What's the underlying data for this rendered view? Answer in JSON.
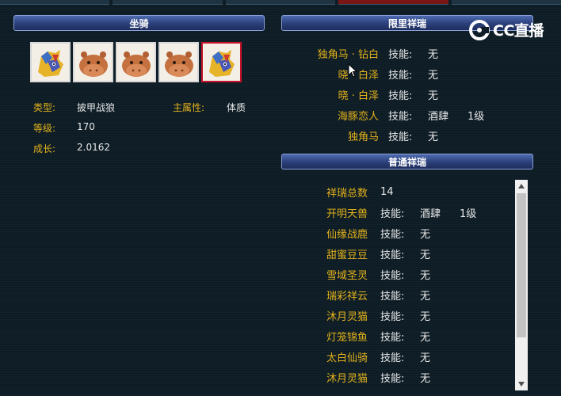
{
  "left_panel": {
    "title": "坐骑",
    "mounts": [
      {
        "icon": "dragon-mount-icon",
        "selected": false
      },
      {
        "icon": "hippo-mount-icon",
        "selected": false
      },
      {
        "icon": "hippo-mount-icon",
        "selected": false
      },
      {
        "icon": "hippo-mount-icon",
        "selected": false
      },
      {
        "icon": "dragon-mount-icon",
        "selected": true
      }
    ],
    "type_label": "类型:",
    "type_value": "披甲战狼",
    "main_attr_label": "主属性:",
    "main_attr_value": "体质",
    "level_label": "等级:",
    "level_value": "170",
    "growth_label": "成长:",
    "growth_value": "2.0162"
  },
  "limited_panel": {
    "title": "限里祥瑞",
    "rows": [
      {
        "name": "独角马 · 钻白",
        "skill_label": "技能:",
        "skill": "无",
        "level": ""
      },
      {
        "name": "晓 · 白泽",
        "skill_label": "技能:",
        "skill": "无",
        "level": ""
      },
      {
        "name": "晓 · 白泽",
        "skill_label": "技能:",
        "skill": "无",
        "level": ""
      },
      {
        "name": "海豚恋人",
        "skill_label": "技能:",
        "skill": "酒肆",
        "level": "1级"
      },
      {
        "name": "独角马",
        "skill_label": "技能:",
        "skill": "无",
        "level": ""
      }
    ]
  },
  "normal_panel": {
    "title": "普通祥瑞",
    "total_label": "祥瑞总数",
    "total_value": "14",
    "rows": [
      {
        "name": "开明天兽",
        "skill_label": "技能:",
        "skill": "酒肆",
        "level": "1级"
      },
      {
        "name": "仙缘战鹿",
        "skill_label": "技能:",
        "skill": "无",
        "level": ""
      },
      {
        "name": "甜蜜豆豆",
        "skill_label": "技能:",
        "skill": "无",
        "level": ""
      },
      {
        "name": "雪域圣灵",
        "skill_label": "技能:",
        "skill": "无",
        "level": ""
      },
      {
        "name": "瑞彩祥云",
        "skill_label": "技能:",
        "skill": "无",
        "level": ""
      },
      {
        "name": "沐月灵猫",
        "skill_label": "技能:",
        "skill": "无",
        "level": ""
      },
      {
        "name": "灯笼锦鱼",
        "skill_label": "技能:",
        "skill": "无",
        "level": ""
      },
      {
        "name": "太白仙骑",
        "skill_label": "技能:",
        "skill": "无",
        "level": ""
      },
      {
        "name": "沐月灵猫",
        "skill_label": "技能:",
        "skill": "无",
        "level": ""
      }
    ]
  },
  "logo": {
    "text": "CC直播"
  },
  "colors": {
    "label": "#e3b21b",
    "value": "#e8e8e8",
    "selected_border": "#c8122a",
    "header": "#2b3f7a"
  }
}
